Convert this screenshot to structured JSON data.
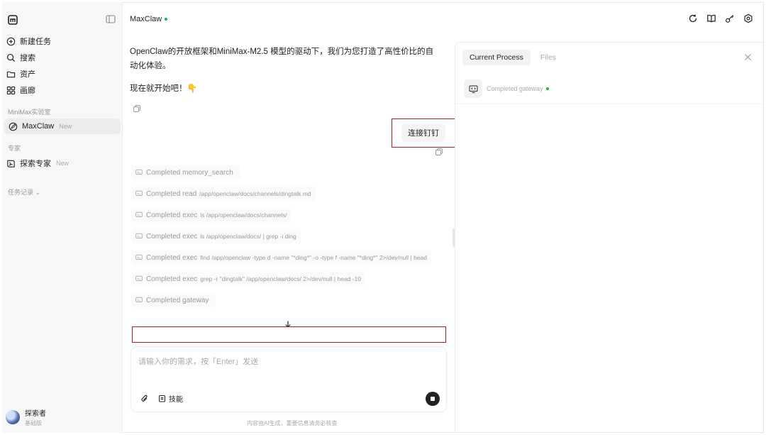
{
  "sidebar": {
    "nav": [
      {
        "label": "新建任务",
        "icon": "plus-circle-icon"
      },
      {
        "label": "搜索",
        "icon": "search-icon"
      },
      {
        "label": "资产",
        "icon": "folder-icon"
      },
      {
        "label": "画廊",
        "icon": "grid-icon"
      }
    ],
    "lab_section": "MiniMax实验室",
    "maxclaw": {
      "label": "MaxClaw",
      "badge": "New"
    },
    "expert_section": "专家",
    "explorer": {
      "label": "探索专家",
      "badge": "New"
    },
    "history_section": "任务记录 ⌄",
    "user": {
      "name": "探索者",
      "plan": "基础版"
    }
  },
  "header": {
    "title": "MaxClaw"
  },
  "chat": {
    "assistant_text": "OpenClaw的开放框架和MiniMax-M2.5 模型的驱动下，我们为您打造了高性价比的自动化体验。",
    "assistant_start": "现在就开始吧！👇",
    "user_message": "连接钉钉",
    "steps": [
      {
        "label": "Completed memory_search",
        "cmd": ""
      },
      {
        "label": "Completed read",
        "cmd": "/app/openclaw/docs/channels/dingtalk.md"
      },
      {
        "label": "Completed exec",
        "cmd": "ls /app/openclaw/docs/channels/"
      },
      {
        "label": "Completed exec",
        "cmd": "ls /app/openclaw/docs/ | grep -i ding"
      },
      {
        "label": "Completed exec",
        "cmd": "find /app/openclaw -type d -name \"*ding*\" -o -type f -name \"*ding*\" 2>/dev/null | head"
      },
      {
        "label": "Completed exec",
        "cmd": "grep -r \"dingtalk\" /app/openclaw/docs/ 2>/dev/null | head -10"
      },
      {
        "label": "Completed gateway",
        "cmd": ""
      }
    ]
  },
  "input": {
    "placeholder": "请输入你的需求，按「Enter」发送",
    "skills_label": "技能"
  },
  "footer_note": "内容由AI生成，重要信息请务必核查",
  "panel": {
    "tabs": [
      "Current Process",
      "Files"
    ],
    "process_status": "Completed gateway"
  }
}
